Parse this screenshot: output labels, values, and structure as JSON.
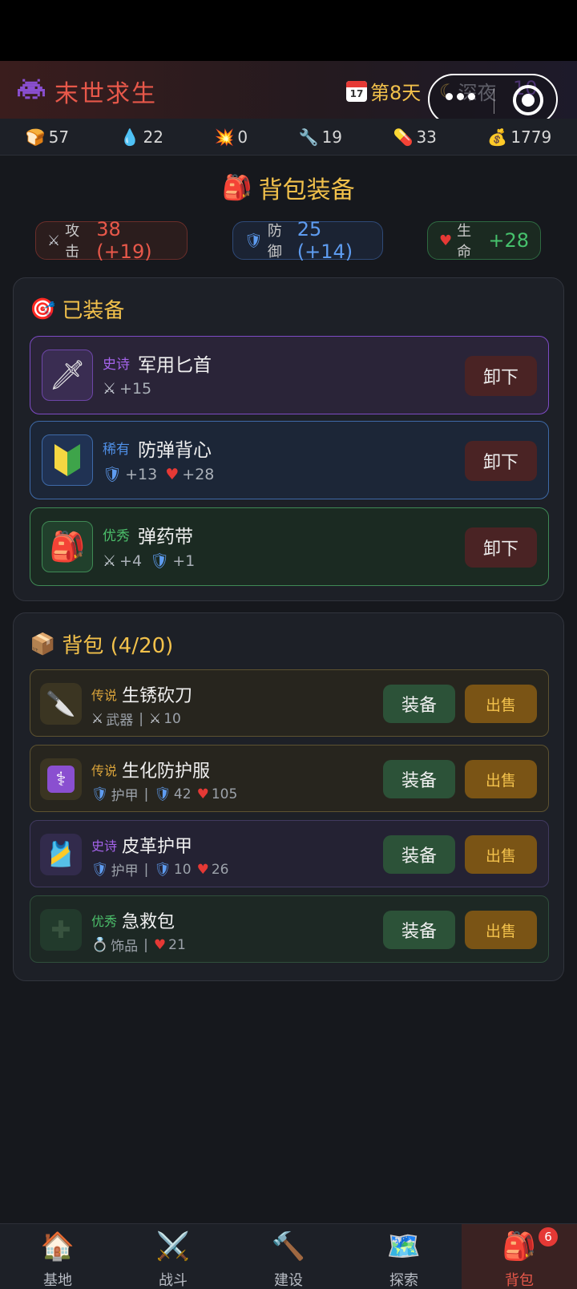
{
  "header": {
    "title": "末世求生",
    "day_label": "第8天",
    "calendar_icon_text": "17",
    "time_label": "深夜",
    "level_partial": "10"
  },
  "resources": [
    {
      "icon": "bread-icon",
      "glyph": "🍞",
      "value": "57"
    },
    {
      "icon": "water-drop-icon",
      "glyph": "💧",
      "value": "22"
    },
    {
      "icon": "explosion-icon",
      "glyph": "💥",
      "value": "0"
    },
    {
      "icon": "wrench-icon",
      "glyph": "🔧",
      "value": "19"
    },
    {
      "icon": "pill-icon",
      "glyph": "💊",
      "value": "33"
    },
    {
      "icon": "money-bag-icon",
      "glyph": "💰",
      "value": "1779"
    }
  ],
  "page_title": "背包装备",
  "stats": {
    "attack": {
      "label": "攻击",
      "value": "38 (+19)"
    },
    "defense": {
      "label": "防御",
      "value": "25 (+14)"
    },
    "health": {
      "label": "生命",
      "value": "+28"
    }
  },
  "equipped": {
    "title": "已装备",
    "unequip_label": "卸下",
    "items": [
      {
        "rarity": "史诗",
        "name": "军用匕首",
        "atk": "+15"
      },
      {
        "rarity": "稀有",
        "name": "防弹背心",
        "def": "+13",
        "hp": "+28"
      },
      {
        "rarity": "优秀",
        "name": "弹药带",
        "atk": "+4",
        "def": "+1"
      }
    ]
  },
  "bag": {
    "title": "背包 (4/20)",
    "equip_label": "装备",
    "sell_label": "出售",
    "items": [
      {
        "rarity": "传说",
        "name": "生锈砍刀",
        "type": "武器",
        "atk": "10"
      },
      {
        "rarity": "传说",
        "name": "生化防护服",
        "type": "护甲",
        "def": "42",
        "hp": "105"
      },
      {
        "rarity": "史诗",
        "name": "皮革护甲",
        "type": "护甲",
        "def": "10",
        "hp": "26"
      },
      {
        "rarity": "优秀",
        "name": "急救包",
        "type": "饰品",
        "hp": "21"
      }
    ]
  },
  "tabs": [
    {
      "label": "基地",
      "icon": "house-icon"
    },
    {
      "label": "战斗",
      "icon": "crossed-swords-icon"
    },
    {
      "label": "建设",
      "icon": "hammer-icon"
    },
    {
      "label": "探索",
      "icon": "map-icon"
    },
    {
      "label": "背包",
      "icon": "backpack-icon",
      "badge": "6"
    }
  ],
  "colors": {
    "accent_gold": "#f2c14b",
    "accent_red": "#e8584a",
    "epic": "#a463ea",
    "rare": "#4f8fe6",
    "good": "#4cbf6b",
    "legendary": "#d9a33a"
  }
}
